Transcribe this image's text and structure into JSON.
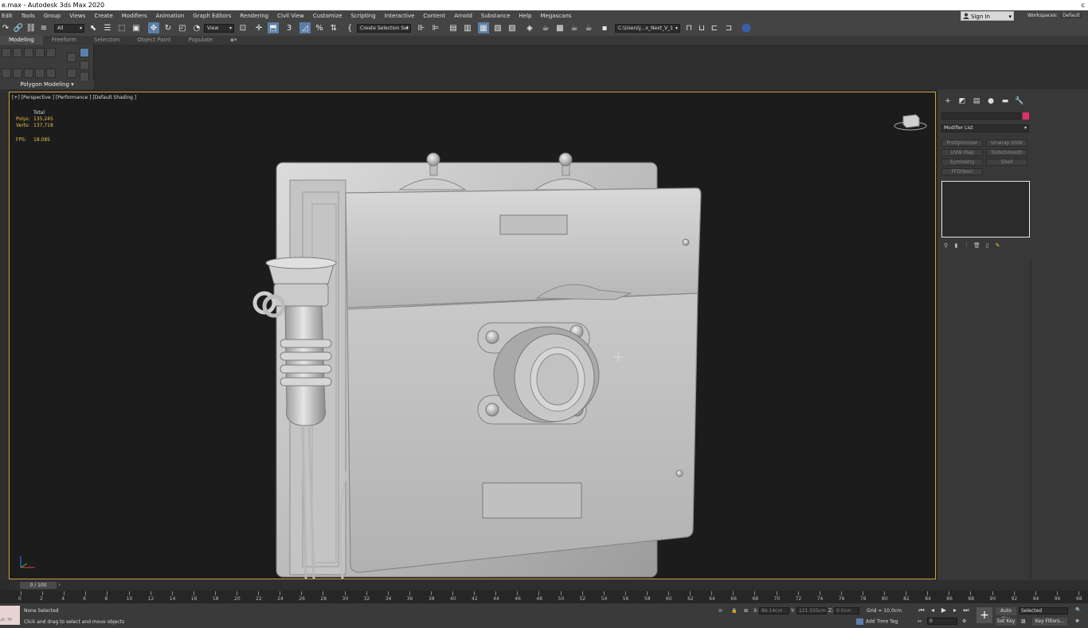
{
  "titlebar": {
    "title": "e.max - Autodesk 3ds Max 2020",
    "controls": "c"
  },
  "menu": [
    "Edit",
    "Tools",
    "Group",
    "Views",
    "Create",
    "Modifiers",
    "Animation",
    "Graph Editors",
    "Rendering",
    "Civil View",
    "Customize",
    "Scripting",
    "Interactive",
    "Content",
    "Arnold",
    "Substance",
    "Help",
    "Megascans"
  ],
  "account": {
    "sign_in": "Sign In",
    "workspaces_label": "Workspaces:",
    "workspaces_value": "Default"
  },
  "toolbar": {
    "filter_all": "All",
    "ref_coord": "View",
    "selection_set": "Create Selection Sel",
    "project_path": "C:\\Users\\j...x_Next_V_1"
  },
  "ribbon": {
    "tabs": [
      "Modeling",
      "Freeform",
      "Selection",
      "Object Paint",
      "Populate"
    ],
    "active_tab": "Modeling",
    "panel_label": "Polygon Modeling"
  },
  "viewport": {
    "label": "[+] [Perspective ] [Performance ] [Default Shading ]",
    "stats": {
      "total_label": "Total",
      "polys_label": "Polys:",
      "polys": "135,245",
      "verts_label": "Verts:",
      "verts": "137,718",
      "fps_label": "FPS:",
      "fps": "18.085"
    },
    "border_color": "#c8a53a"
  },
  "command_panel": {
    "modifier_list": "Modifier List",
    "object_color": "#e0306e",
    "modifier_buttons": [
      "ProOptimizer",
      "Unwrap UVW",
      "UVW Map",
      "TurboSmooth",
      "Symmetry",
      "Shell",
      "FFD(box)"
    ]
  },
  "time_slider": {
    "frame": "0 / 100"
  },
  "track_ticks": [
    0,
    2,
    4,
    6,
    8,
    10,
    12,
    14,
    16,
    18,
    20,
    22,
    24,
    26,
    28,
    30,
    32,
    34,
    36,
    38,
    40,
    42,
    44,
    46,
    48,
    50,
    52,
    54,
    56,
    58,
    60,
    62,
    64,
    66,
    68,
    70,
    72,
    74,
    76,
    78,
    80,
    82,
    84,
    86,
    88,
    90,
    92,
    94,
    96,
    98
  ],
  "status": {
    "thumb_text": "pt: Mi",
    "selection": "None Selected",
    "prompt": "Click and drag to select and move objects",
    "x_label": "X:",
    "x": "86.14cm",
    "y_label": "Y:",
    "y": "121.555cm",
    "z_label": "Z:",
    "z": "0.0cm",
    "grid": "Grid = 10.0cm",
    "add_time_tag": "Add Time Tag",
    "auto_key": "Auto Key",
    "set_key": "Set Key",
    "selected": "Selected",
    "key_filters": "Key Filters...",
    "current_frame": "0"
  }
}
